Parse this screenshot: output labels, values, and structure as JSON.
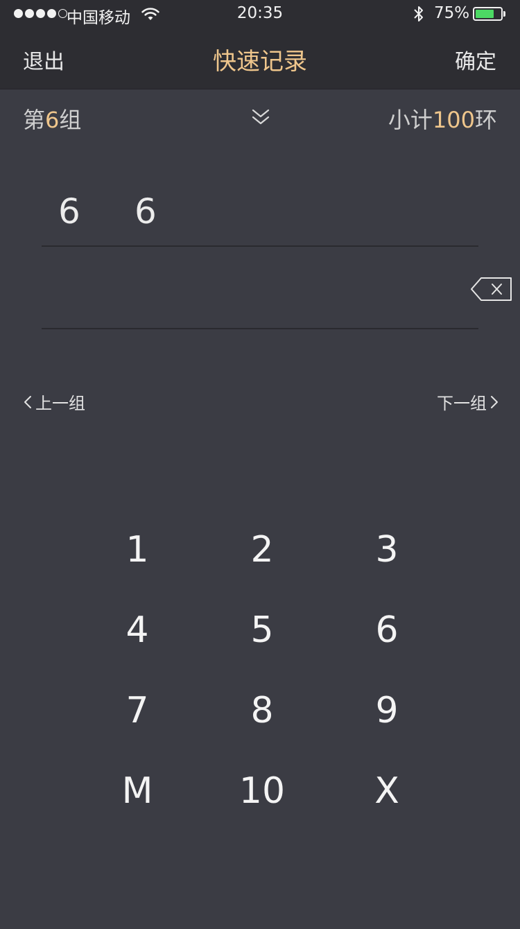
{
  "status_bar": {
    "carrier": "中国移动",
    "time": "20:35",
    "battery_percent": "75%",
    "battery_level": 0.75,
    "signal_bars_filled": 4,
    "battery_color": "#4cd964"
  },
  "nav": {
    "left_label": "退出",
    "title": "快速记录",
    "right_label": "确定",
    "title_color": "#efc68c"
  },
  "group": {
    "prefix": "第",
    "number": "6",
    "suffix": "组",
    "subtotal_prefix": "小计",
    "subtotal_value": "100",
    "subtotal_suffix": "环",
    "expand_icon": "chevron-double-down-icon"
  },
  "scores": {
    "row1": [
      "6",
      "6"
    ],
    "row2": []
  },
  "navigation": {
    "prev_label": "上一组",
    "next_label": "下一组"
  },
  "keypad": {
    "keys": [
      "1",
      "2",
      "3",
      "4",
      "5",
      "6",
      "7",
      "8",
      "9",
      "M",
      "10",
      "X"
    ]
  }
}
